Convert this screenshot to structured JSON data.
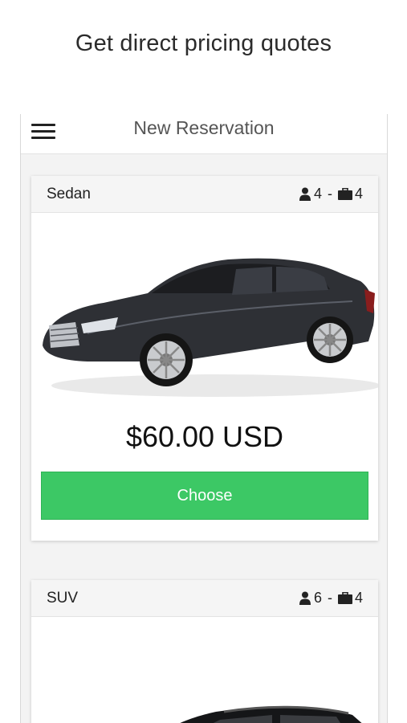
{
  "headline": "Get direct pricing quotes",
  "nav": {
    "title": "New Reservation",
    "menu_icon": "hamburger-menu-icon"
  },
  "vehicles": [
    {
      "name": "Sedan",
      "passengers": "4",
      "separator": "-",
      "luggage": "4",
      "price": "$60.00 USD",
      "button_label": "Choose"
    },
    {
      "name": "SUV",
      "passengers": "6",
      "separator": "-",
      "luggage": "4"
    }
  ],
  "colors": {
    "button": "#3cc865",
    "card_header": "#f5f5f5",
    "car_body": "#2e3035"
  }
}
